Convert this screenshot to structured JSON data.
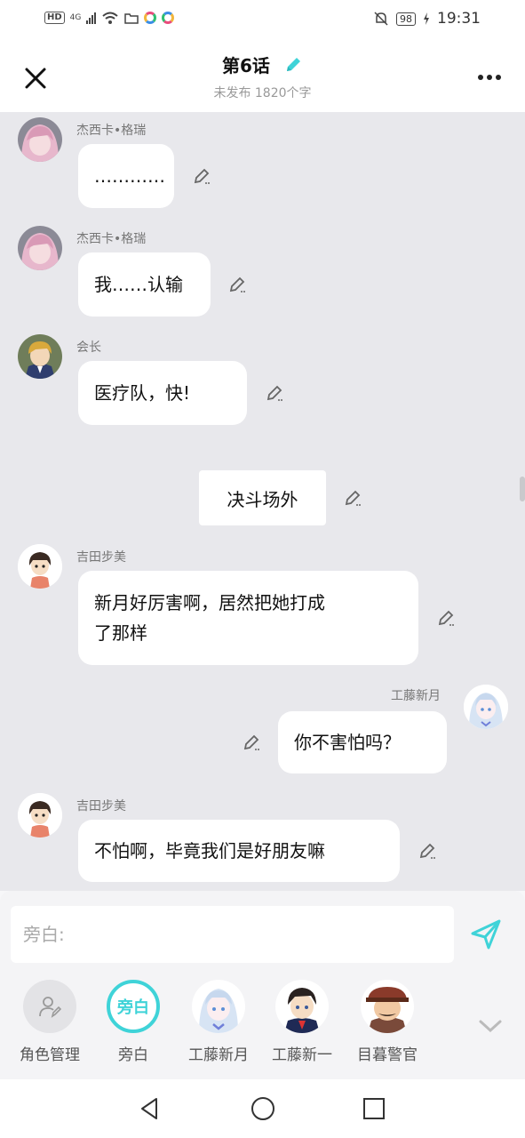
{
  "status_bar": {
    "hd_badge": "HD",
    "network": "4G",
    "battery": "98",
    "time": "19:31"
  },
  "header": {
    "title": "第6话",
    "subtitle": "未发布 1820个字"
  },
  "messages": [
    {
      "type": "left",
      "speaker": "杰西卡•格瑞",
      "text": "…………",
      "avatar": "pink-hair-girl"
    },
    {
      "type": "left",
      "speaker": "杰西卡•格瑞",
      "text": "我……认输",
      "avatar": "pink-hair-girl"
    },
    {
      "type": "left",
      "speaker": "会长",
      "text": "医疗队，快!",
      "avatar": "blond-boy"
    },
    {
      "type": "narration",
      "text": "决斗场外"
    },
    {
      "type": "left",
      "speaker": "吉田步美",
      "text_line1": "新月好厉害啊，居然把她打成",
      "text_line2": "了那样",
      "avatar": "ayumi"
    },
    {
      "type": "right",
      "speaker": "工藤新月",
      "text": "你不害怕吗？",
      "avatar": "white-hair-girl"
    },
    {
      "type": "left",
      "speaker": "吉田步美",
      "text": "不怕啊，毕竟我们是好朋友嘛",
      "avatar": "ayumi"
    }
  ],
  "composer": {
    "placeholder": "旁白:"
  },
  "roles": [
    {
      "label": "角色管理",
      "kind": "manage"
    },
    {
      "label": "旁白",
      "kind": "narrator",
      "badge": "旁白",
      "selected": true
    },
    {
      "label": "工藤新月",
      "kind": "avatar"
    },
    {
      "label": "工藤新一",
      "kind": "avatar"
    },
    {
      "label": "目暮警官",
      "kind": "avatar"
    }
  ],
  "colors": {
    "accent": "#3fd3d8",
    "chat_bg": "#e8e8ec",
    "bubble": "#ffffff"
  }
}
